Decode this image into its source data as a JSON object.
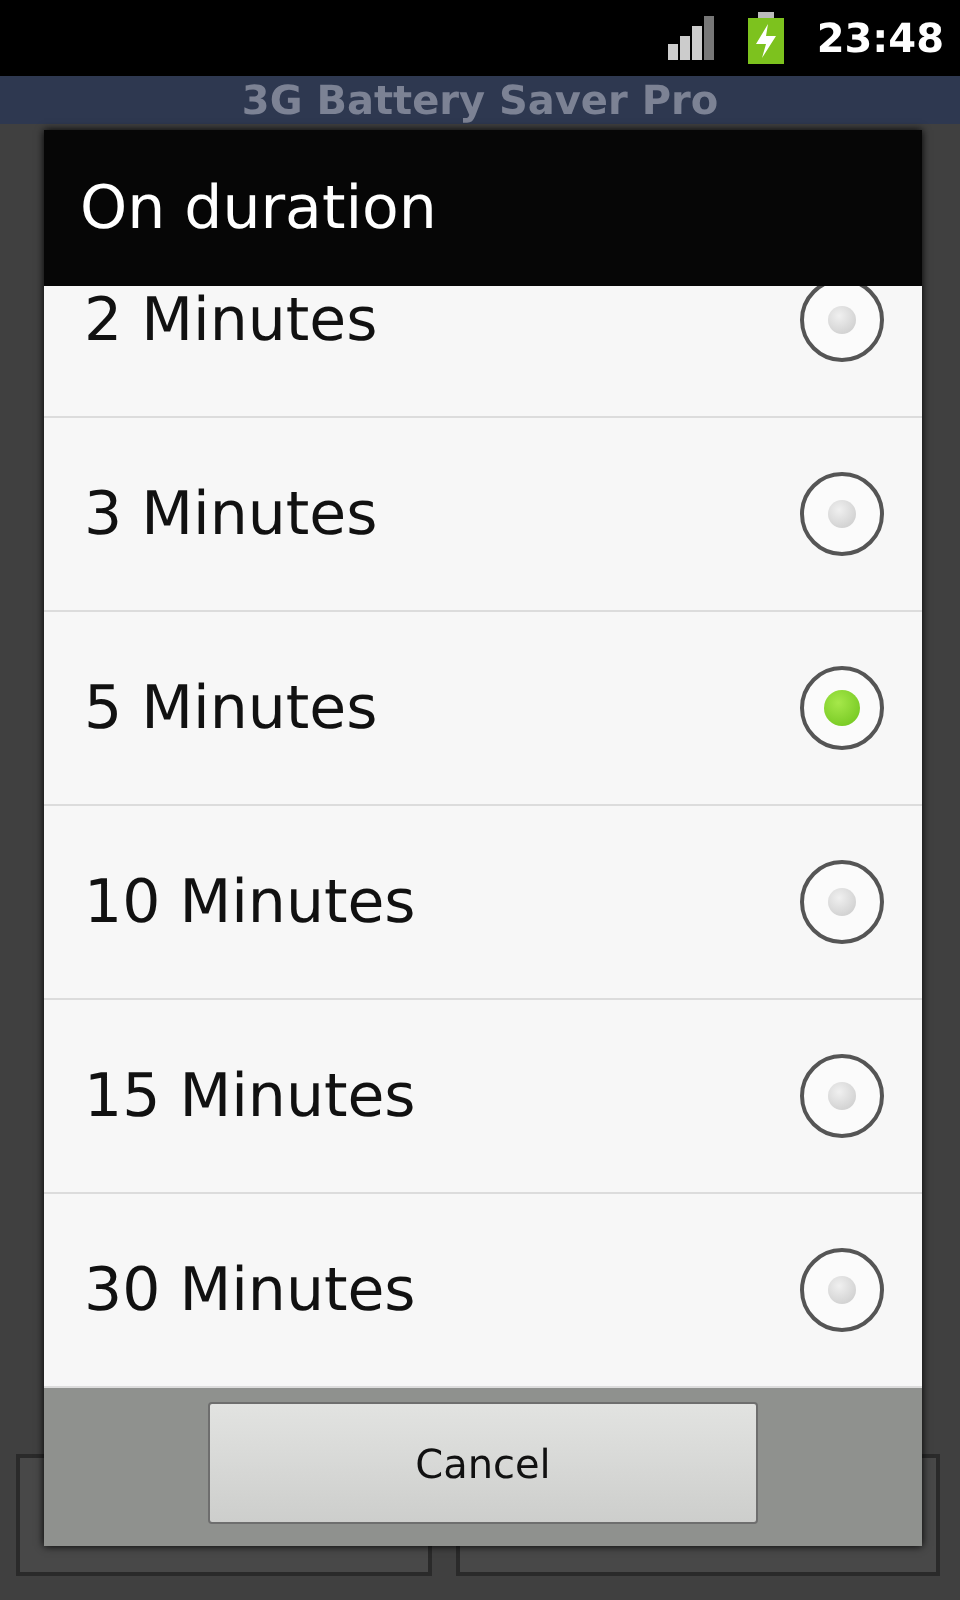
{
  "status_bar": {
    "time": "23:48"
  },
  "app": {
    "title": "3G Battery Saver Pro"
  },
  "dialog": {
    "title": "On duration",
    "options": [
      {
        "label": "2 Minutes",
        "selected": false
      },
      {
        "label": "3 Minutes",
        "selected": false
      },
      {
        "label": "5 Minutes",
        "selected": true
      },
      {
        "label": "10 Minutes",
        "selected": false
      },
      {
        "label": "15 Minutes",
        "selected": false
      },
      {
        "label": "30 Minutes",
        "selected": false
      }
    ],
    "buttons": [
      "Cancel"
    ]
  }
}
